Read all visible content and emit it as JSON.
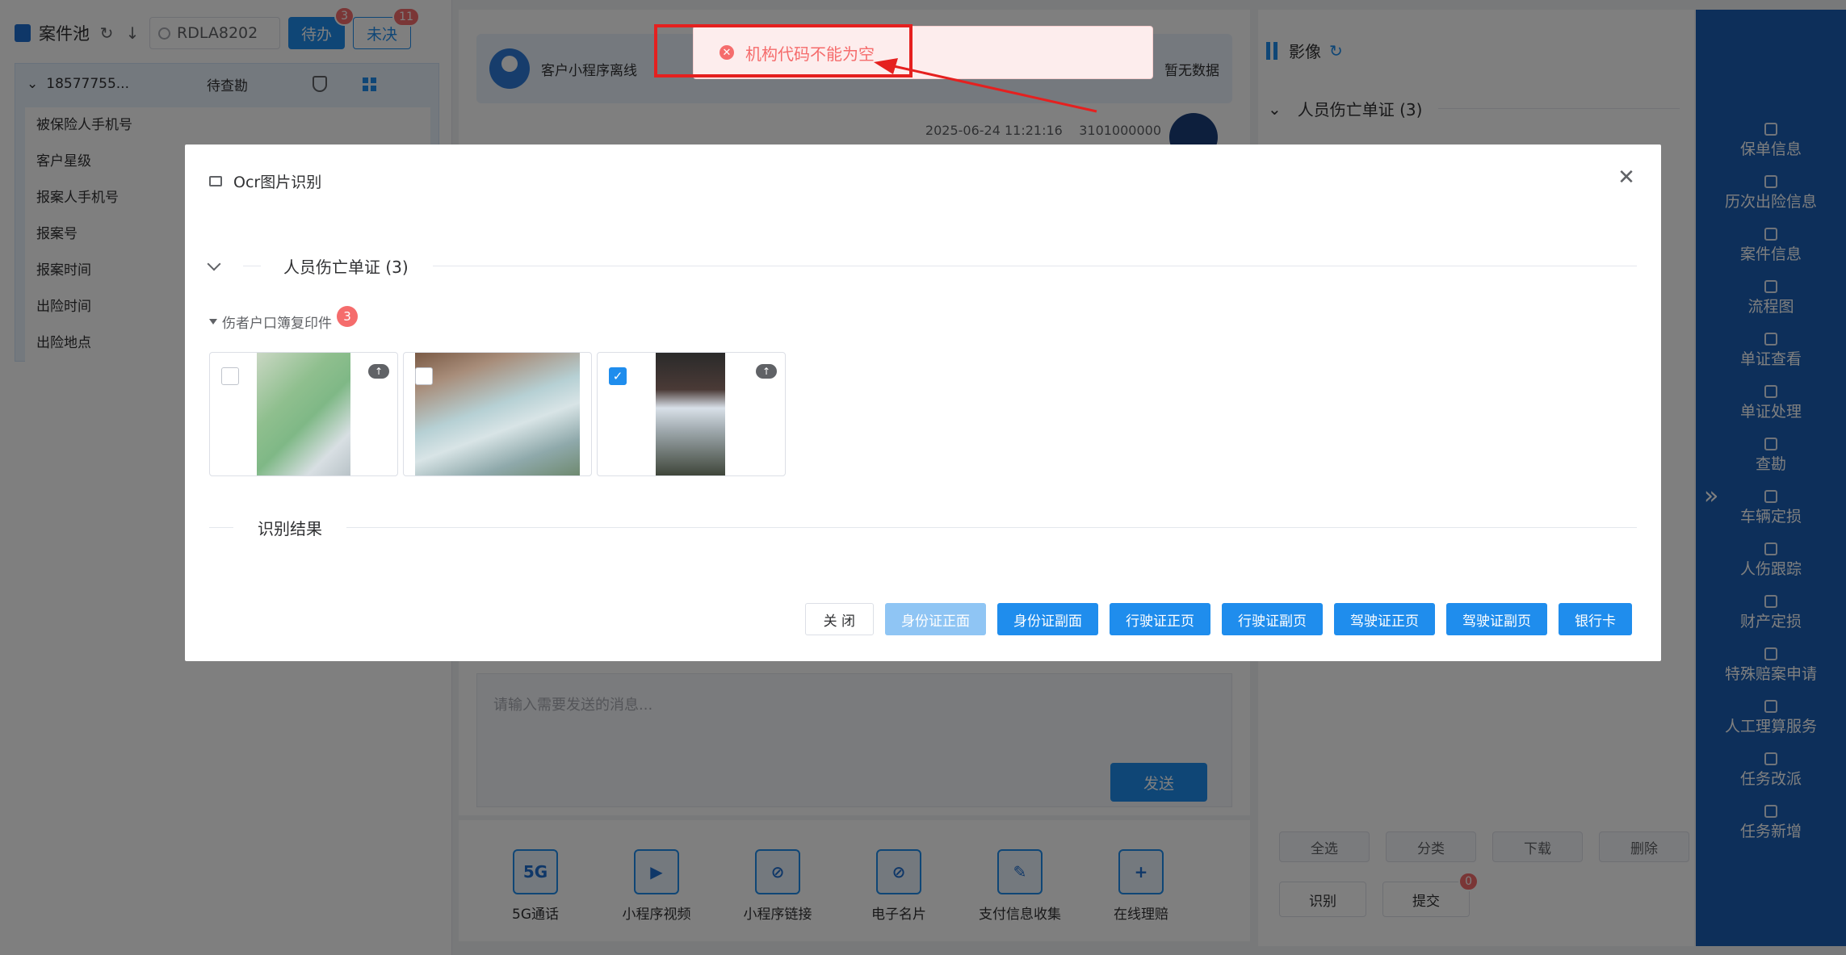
{
  "left": {
    "title": "案件池",
    "search_value": "RDLA8202",
    "todo_label": "待办",
    "todo_count": "3",
    "undone_label": "未决",
    "undone_count": "11",
    "case_id": "18577755...",
    "case_status": "待查勘",
    "fields": [
      "被保险人手机号",
      "客户星级",
      "报案人手机号",
      "报案号",
      "报案时间",
      "出险时间",
      "出险地点"
    ]
  },
  "center": {
    "customer_label": "客户小程序离线",
    "nodata_label": "暂无数据",
    "msg_time": "2025-06-24 11:21:16",
    "msg_code": "3101000000",
    "input_placeholder": "请输入需要发送的消息...",
    "send_label": "发送",
    "tools": [
      "5G通话",
      "小程序视频",
      "小程序链接",
      "电子名片",
      "支付信息收集",
      "在线理赔"
    ]
  },
  "right": {
    "title": "影像",
    "section": "人员伤亡单证 (3)",
    "btn_select_all": "全选",
    "btn_classify": "分类",
    "btn_download": "下载",
    "btn_delete": "删除",
    "btn_recognize": "识别",
    "btn_submit": "提交",
    "submit_count": "0"
  },
  "side_nav": [
    "保单信息",
    "历次出险信息",
    "案件信息",
    "流程图",
    "单证查看",
    "单证处理",
    "查勘",
    "车辆定损",
    "人伤跟踪",
    "财产定损",
    "特殊赔案申请",
    "人工理算服务",
    "任务改派",
    "任务新增"
  ],
  "toast": {
    "message": "机构代码不能为空",
    "icon": "error-icon",
    "color": "#f56c6c"
  },
  "dialog": {
    "title": "Ocr图片识别",
    "section1": "人员伤亡单证 (3)",
    "group_label": "伤者户口簿复印件",
    "group_count": "3",
    "images": [
      {
        "checked": false
      },
      {
        "checked": false
      },
      {
        "checked": true
      }
    ],
    "section2": "识别结果",
    "buttons": {
      "close": "关 闭",
      "id_front": "身份证正面",
      "id_back": "身份证副面",
      "vehicle_front": "行驶证正页",
      "vehicle_back": "行驶证副页",
      "driver_front": "驾驶证正页",
      "driver_back": "驾驶证副页",
      "bank_card": "银行卡"
    }
  },
  "colors": {
    "primary": "#1f8ded",
    "danger": "#f56c6c",
    "nav": "#1a5fb4",
    "highlight": "#e5201f"
  }
}
